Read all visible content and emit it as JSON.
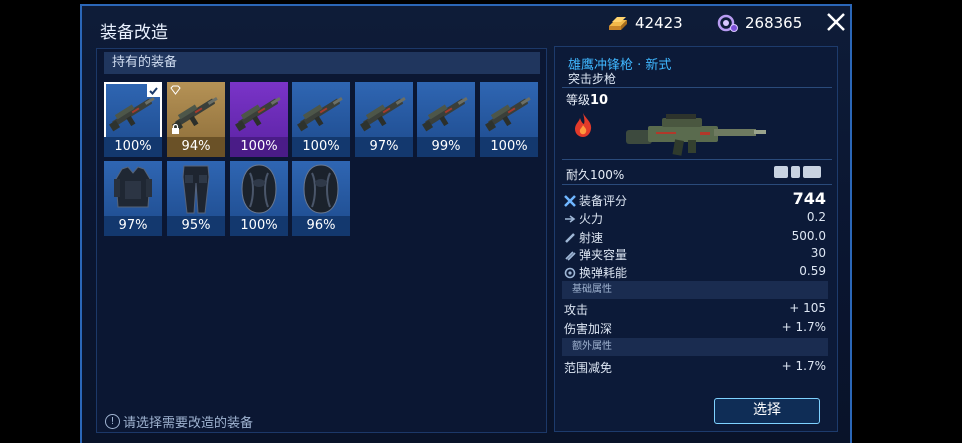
{
  "title": "装备改造",
  "currency": [
    {
      "icon": "gold-bar-icon",
      "value": "42423"
    },
    {
      "icon": "energy-orb-icon",
      "value": "268365"
    }
  ],
  "owned_header": "持有的装备",
  "slots": [
    {
      "kind": "weapon",
      "rarity": "blue",
      "pct": "100%",
      "selected": true
    },
    {
      "kind": "weapon",
      "rarity": "gold",
      "pct": "94%",
      "gem": true,
      "locked": true
    },
    {
      "kind": "weapon",
      "rarity": "purple",
      "pct": "100%"
    },
    {
      "kind": "weapon",
      "rarity": "blue",
      "pct": "100%"
    },
    {
      "kind": "weapon",
      "rarity": "blue",
      "pct": "97%"
    },
    {
      "kind": "weapon",
      "rarity": "blue",
      "pct": "99%"
    },
    {
      "kind": "weapon",
      "rarity": "blue",
      "pct": "100%"
    },
    {
      "kind": "armor-vest",
      "rarity": "blue",
      "pct": "97%"
    },
    {
      "kind": "armor-pants",
      "rarity": "blue",
      "pct": "95%"
    },
    {
      "kind": "backpack",
      "rarity": "blue",
      "pct": "100%"
    },
    {
      "kind": "backpack",
      "rarity": "blue",
      "pct": "96%"
    }
  ],
  "hint": "请选择需要改造的装备",
  "detail": {
    "name": "雄鹰冲锋枪 · 新式",
    "type": "突击步枪",
    "level_label": "等级",
    "level": "10",
    "durability": "耐久100%",
    "stats": [
      {
        "icon": "gear-score-icon",
        "label": "装备评分",
        "value": "744"
      },
      {
        "icon": "firepower-icon",
        "label": "火力",
        "value": "0.2"
      },
      {
        "icon": "fire-rate-icon",
        "label": "射速",
        "value": "500.0"
      },
      {
        "icon": "magazine-icon",
        "label": "弹夹容量",
        "value": "30"
      },
      {
        "icon": "reload-icon",
        "label": "换弹耗能",
        "value": "0.59"
      }
    ],
    "base_section": "基础属性",
    "base_attrs": [
      {
        "label": "攻击",
        "value": "+ 105"
      },
      {
        "label": "伤害加深",
        "value": "+ 1.7%"
      }
    ],
    "extra_section": "额外属性",
    "extra_attrs": [
      {
        "label": "范围减免",
        "value": "+ 1.7%"
      }
    ]
  },
  "select_label": "选择",
  "colors": {
    "accent": "#3fb7ff",
    "frame": "#2b67b8",
    "purple": "#7a34c8",
    "gold": "#b59256",
    "blue": "#2f66b3"
  }
}
